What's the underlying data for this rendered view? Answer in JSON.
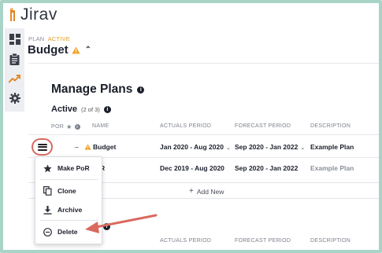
{
  "app": {
    "logo_text": "Jirav"
  },
  "sidebar": {
    "items": [
      {
        "icon": "dashboard-icon"
      },
      {
        "icon": "clipboard-icon"
      },
      {
        "icon": "trend-chart-icon"
      },
      {
        "icon": "gear-icon"
      }
    ]
  },
  "header": {
    "kicker": "PLAN",
    "status": "ACTIVE",
    "title": "Budget",
    "status_color": "#e59b1f"
  },
  "manage": {
    "title": "Manage Plans",
    "active_label": "Active",
    "active_count": "(2 of 3)",
    "columns": {
      "por": "POR",
      "name": "NAME",
      "actuals": "ACTUALS PERIOD",
      "forecast": "FORECAST PERIOD",
      "description": "DESCRIPTION"
    },
    "rows": [
      {
        "name": "Budget",
        "actuals": "Jan 2020 - Aug 2020",
        "forecast": "Sep 2020 - Jan 2022",
        "description": "Example Plan"
      },
      {
        "name": "R",
        "actuals": "Dec 2019 - Aug 2020",
        "forecast": "Sep 2020 - Jan 2022",
        "description": "Example Plan"
      }
    ],
    "add_new": "Add New",
    "bottom_column": "ACTUALS PERIOD",
    "bottom_column_2": "FORECAST PERIOD",
    "bottom_column_3": "DESCRIPTION"
  },
  "menu": {
    "items": [
      {
        "label": "Make PoR",
        "icon": "star-icon"
      },
      {
        "label": "Clone",
        "icon": "copy-icon"
      },
      {
        "label": "Archive",
        "icon": "archive-download-icon"
      },
      {
        "label": "Delete",
        "icon": "minus-circle-icon"
      }
    ]
  },
  "colors": {
    "frame": "#a9d3c7",
    "callout": "#d9695f",
    "sidebar_bg": "#edeef2"
  }
}
